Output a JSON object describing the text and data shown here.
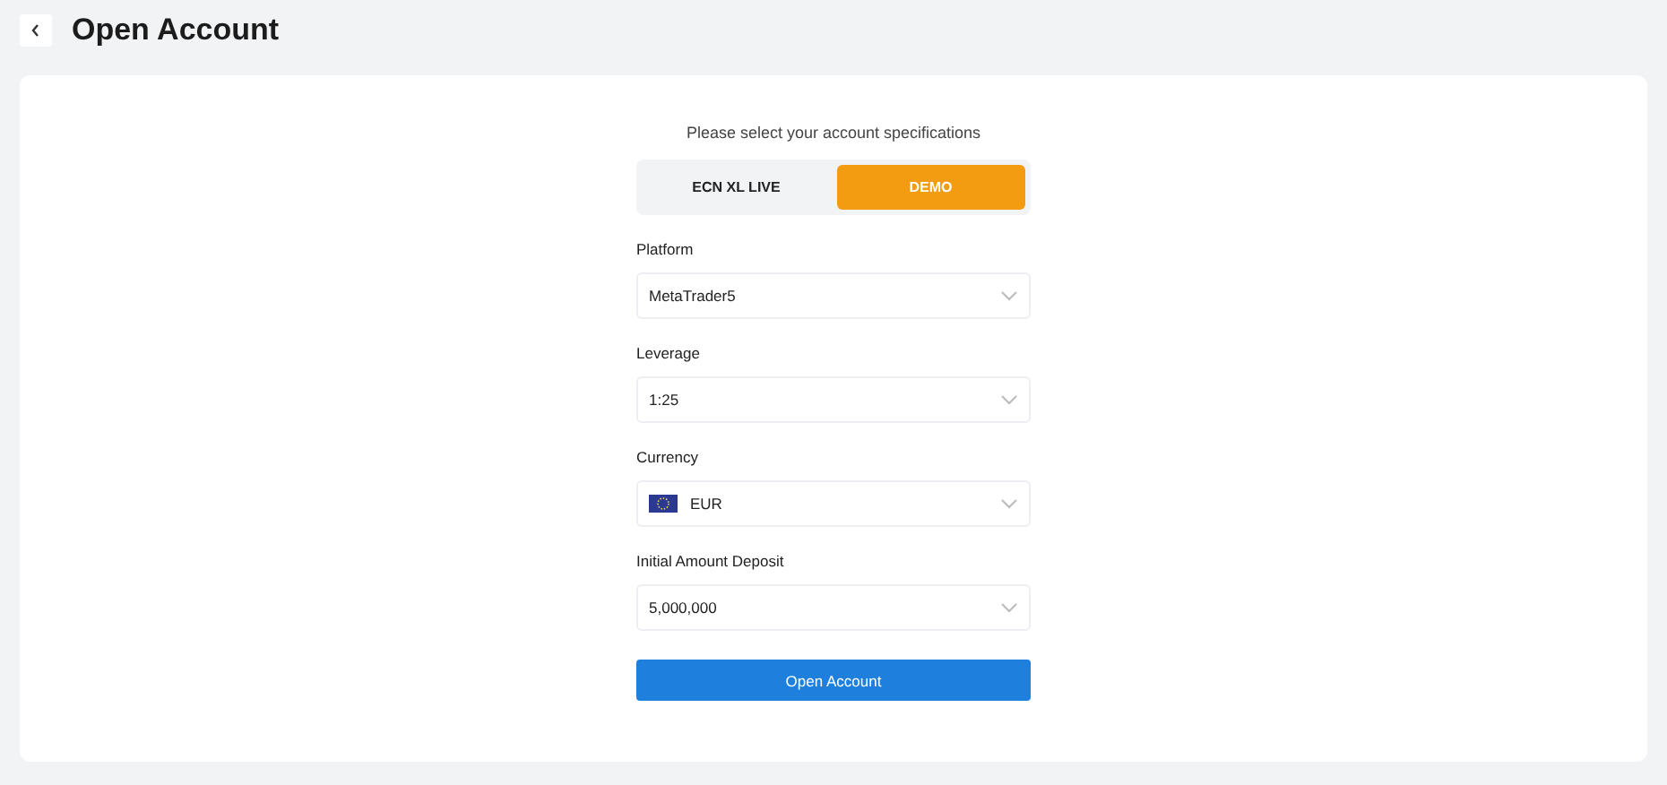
{
  "header": {
    "title": "Open Account"
  },
  "prompt": "Please select your account specifications",
  "account_types": [
    {
      "label": "ECN XL LIVE",
      "selected": false
    },
    {
      "label": "DEMO",
      "selected": true
    }
  ],
  "fields": [
    {
      "kind": "select",
      "label": "Platform",
      "value": "MetaTrader5"
    },
    {
      "kind": "select",
      "label": "Leverage",
      "value": "1:25"
    },
    {
      "kind": "flag-select",
      "label": "Currency",
      "value": "EUR"
    },
    {
      "kind": "select",
      "label": "Initial Amount Deposit",
      "value": "5,000,000"
    }
  ],
  "submit": "Open Account"
}
